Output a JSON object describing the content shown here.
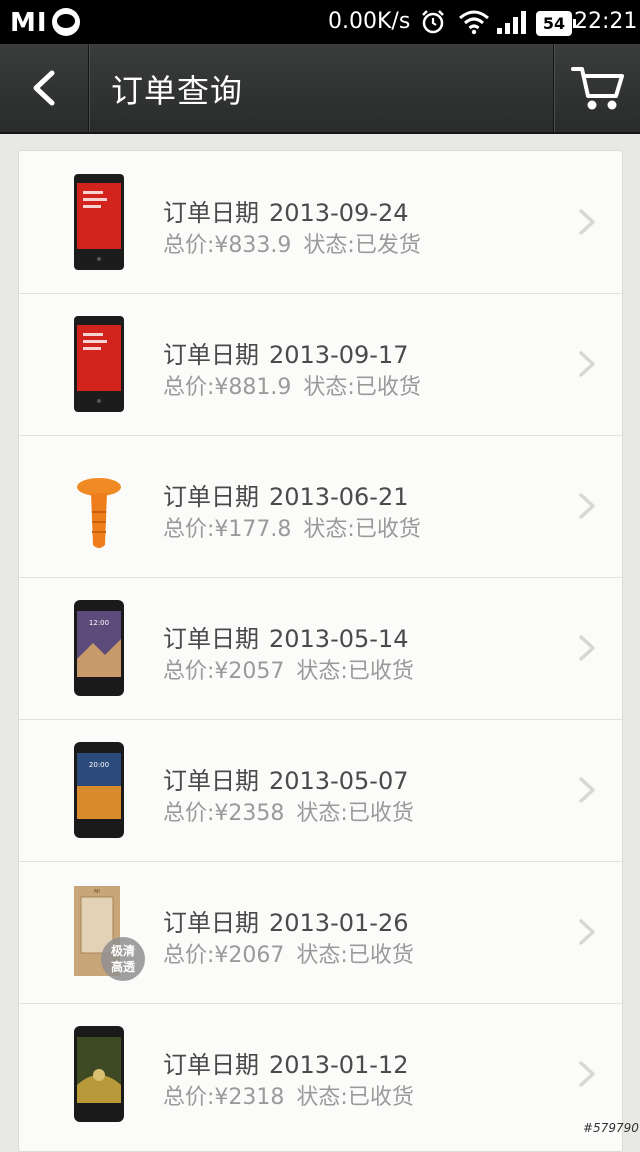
{
  "status_bar": {
    "carrier_logo": "MI",
    "net_speed": "0.00K/s",
    "battery": "54",
    "time": "22:21",
    "icons": [
      "alarm-icon",
      "wifi-icon",
      "signal-icon",
      "battery-icon"
    ]
  },
  "action_bar": {
    "title": "订单查询",
    "back_icon": "chevron-left-icon",
    "cart_icon": "cart-icon"
  },
  "orders": [
    {
      "date_label": "订单日期",
      "date": "2013-09-24",
      "price": "总价:¥833.9",
      "status": "状态:已发货",
      "thumb": "red-phone"
    },
    {
      "date_label": "订单日期",
      "date": "2013-09-17",
      "price": "总价:¥881.9",
      "status": "状态:已收货",
      "thumb": "red-phone"
    },
    {
      "date_label": "订单日期",
      "date": "2013-06-21",
      "price": "总价:¥177.8",
      "status": "状态:已收货",
      "thumb": "orange-plug"
    },
    {
      "date_label": "订单日期",
      "date": "2013-05-14",
      "price": "总价:¥2057",
      "status": "状态:已收货",
      "thumb": "black-phone-purple"
    },
    {
      "date_label": "订单日期",
      "date": "2013-05-07",
      "price": "总价:¥2358",
      "status": "状态:已收货",
      "thumb": "black-phone-orange"
    },
    {
      "date_label": "订单日期",
      "date": "2013-01-26",
      "price": "总价:¥2067",
      "status": "状态:已收货",
      "thumb": "screen-protector",
      "thumb_label_1": "极清",
      "thumb_label_2": "高透"
    },
    {
      "date_label": "订单日期",
      "date": "2013-01-12",
      "price": "总价:¥2318",
      "status": "状态:已收货",
      "thumb": "black-phone-green"
    }
  ],
  "watermark": "#579790",
  "colors": {
    "action_bar": "#2f3230",
    "card_bg": "#fbfcfa",
    "primary_text": "#4a4a4a",
    "secondary_text": "#9a9a9a"
  }
}
